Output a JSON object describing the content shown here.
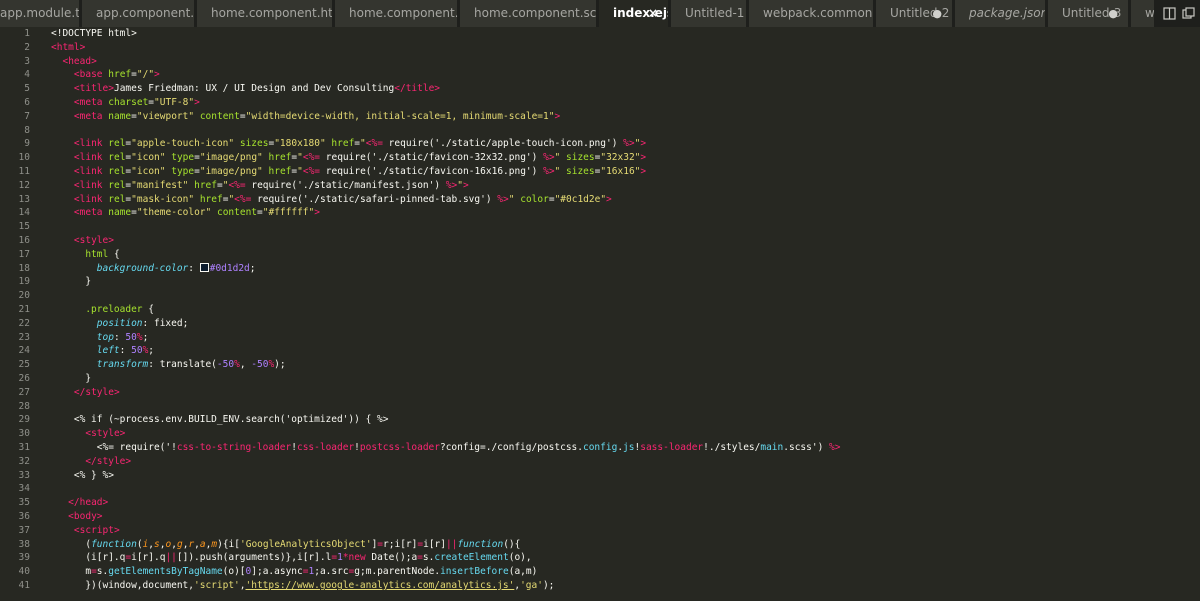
{
  "tabs": [
    {
      "label": "app.module.ts",
      "state": "",
      "active": false,
      "italic": false
    },
    {
      "label": "app.component.ts",
      "state": "",
      "active": false,
      "italic": false
    },
    {
      "label": "home.component.html",
      "state": "",
      "active": false,
      "italic": false
    },
    {
      "label": "home.component.ts",
      "state": "",
      "active": false,
      "italic": false
    },
    {
      "label": "home.component.scss",
      "state": "",
      "active": false,
      "italic": false
    },
    {
      "label": "index.ejs",
      "state": "×",
      "active": true,
      "italic": false
    },
    {
      "label": "Untitled-1",
      "state": "",
      "active": false,
      "italic": false
    },
    {
      "label": "webpack.common.js",
      "state": "",
      "active": false,
      "italic": false
    },
    {
      "label": "Untitled-2",
      "state": "●",
      "active": false,
      "italic": false
    },
    {
      "label": "package.json",
      "state": "",
      "active": false,
      "italic": true
    },
    {
      "label": "Untitled-3",
      "state": "●",
      "active": false,
      "italic": false
    },
    {
      "label": "wel",
      "state": "",
      "active": false,
      "italic": false
    }
  ],
  "icons": {
    "split": "split-editor-icon",
    "more": "more-actions-icon"
  },
  "colors": {
    "background": "#272822",
    "tag": "#f92672",
    "attribute": "#a6e22e",
    "string": "#e6db74",
    "property": "#66d9ef",
    "number": "#ae81ff"
  },
  "lines": [
    [
      [
        "t",
        "<!DOCTYPE html>"
      ]
    ],
    [
      [
        "g",
        "<"
      ],
      [
        "tag",
        "html"
      ],
      [
        "g",
        ">"
      ]
    ],
    [
      [
        "t",
        "  "
      ],
      [
        "g",
        "<"
      ],
      [
        "tag",
        "head"
      ],
      [
        "g",
        ">"
      ]
    ],
    [
      [
        "t",
        "    "
      ],
      [
        "g",
        "<"
      ],
      [
        "tag",
        "base"
      ],
      [
        "t",
        " "
      ],
      [
        "attr",
        "href"
      ],
      [
        "t",
        "="
      ],
      [
        "str",
        "\"/\""
      ],
      [
        "g",
        ">"
      ]
    ],
    [
      [
        "t",
        "    "
      ],
      [
        "g",
        "<"
      ],
      [
        "tag",
        "title"
      ],
      [
        "g",
        ">"
      ],
      [
        "t",
        "James Friedman: UX / UI Design and Dev Consulting"
      ],
      [
        "g",
        "</"
      ],
      [
        "tag",
        "title"
      ],
      [
        "g",
        ">"
      ]
    ],
    [
      [
        "t",
        "    "
      ],
      [
        "g",
        "<"
      ],
      [
        "tag",
        "meta"
      ],
      [
        "t",
        " "
      ],
      [
        "attr",
        "charset"
      ],
      [
        "t",
        "="
      ],
      [
        "str",
        "\"UTF-8\""
      ],
      [
        "g",
        ">"
      ]
    ],
    [
      [
        "t",
        "    "
      ],
      [
        "g",
        "<"
      ],
      [
        "tag",
        "meta"
      ],
      [
        "t",
        " "
      ],
      [
        "attr",
        "name"
      ],
      [
        "t",
        "="
      ],
      [
        "str",
        "\"viewport\""
      ],
      [
        "t",
        " "
      ],
      [
        "attr",
        "content"
      ],
      [
        "t",
        "="
      ],
      [
        "str",
        "\"width=device-width, initial-scale=1, minimum-scale=1\""
      ],
      [
        "g",
        ">"
      ]
    ],
    [],
    [
      [
        "t",
        "    "
      ],
      [
        "g",
        "<"
      ],
      [
        "tag",
        "link"
      ],
      [
        "t",
        " "
      ],
      [
        "attr",
        "rel"
      ],
      [
        "t",
        "="
      ],
      [
        "str",
        "\"apple-touch-icon\""
      ],
      [
        "t",
        " "
      ],
      [
        "attr",
        "sizes"
      ],
      [
        "t",
        "="
      ],
      [
        "str",
        "\"180x180\""
      ],
      [
        "t",
        " "
      ],
      [
        "attr",
        "href"
      ],
      [
        "t",
        "="
      ],
      [
        "str",
        "\""
      ],
      [
        "tag",
        "<%="
      ],
      [
        "t",
        " require('./static/apple-touch-icon.png') "
      ],
      [
        "tag",
        "%>"
      ],
      [
        "str",
        "\""
      ],
      [
        "g",
        ">"
      ]
    ],
    [
      [
        "t",
        "    "
      ],
      [
        "g",
        "<"
      ],
      [
        "tag",
        "link"
      ],
      [
        "t",
        " "
      ],
      [
        "attr",
        "rel"
      ],
      [
        "t",
        "="
      ],
      [
        "str",
        "\"icon\""
      ],
      [
        "t",
        " "
      ],
      [
        "attr",
        "type"
      ],
      [
        "t",
        "="
      ],
      [
        "str",
        "\"image/png\""
      ],
      [
        "t",
        " "
      ],
      [
        "attr",
        "href"
      ],
      [
        "t",
        "="
      ],
      [
        "str",
        "\""
      ],
      [
        "tag",
        "<%="
      ],
      [
        "t",
        " require('./static/favicon-32x32.png') "
      ],
      [
        "tag",
        "%>"
      ],
      [
        "str",
        "\""
      ],
      [
        "t",
        " "
      ],
      [
        "attr",
        "sizes"
      ],
      [
        "t",
        "="
      ],
      [
        "str",
        "\"32x32\""
      ],
      [
        "g",
        ">"
      ]
    ],
    [
      [
        "t",
        "    "
      ],
      [
        "g",
        "<"
      ],
      [
        "tag",
        "link"
      ],
      [
        "t",
        " "
      ],
      [
        "attr",
        "rel"
      ],
      [
        "t",
        "="
      ],
      [
        "str",
        "\"icon\""
      ],
      [
        "t",
        " "
      ],
      [
        "attr",
        "type"
      ],
      [
        "t",
        "="
      ],
      [
        "str",
        "\"image/png\""
      ],
      [
        "t",
        " "
      ],
      [
        "attr",
        "href"
      ],
      [
        "t",
        "="
      ],
      [
        "str",
        "\""
      ],
      [
        "tag",
        "<%="
      ],
      [
        "t",
        " require('./static/favicon-16x16.png') "
      ],
      [
        "tag",
        "%>"
      ],
      [
        "str",
        "\""
      ],
      [
        "t",
        " "
      ],
      [
        "attr",
        "sizes"
      ],
      [
        "t",
        "="
      ],
      [
        "str",
        "\"16x16\""
      ],
      [
        "g",
        ">"
      ]
    ],
    [
      [
        "t",
        "    "
      ],
      [
        "g",
        "<"
      ],
      [
        "tag",
        "link"
      ],
      [
        "t",
        " "
      ],
      [
        "attr",
        "rel"
      ],
      [
        "t",
        "="
      ],
      [
        "str",
        "\"manifest\""
      ],
      [
        "t",
        " "
      ],
      [
        "attr",
        "href"
      ],
      [
        "t",
        "="
      ],
      [
        "str",
        "\""
      ],
      [
        "tag",
        "<%="
      ],
      [
        "t",
        " require('./static/manifest.json') "
      ],
      [
        "tag",
        "%>"
      ],
      [
        "str",
        "\""
      ],
      [
        "g",
        ">"
      ]
    ],
    [
      [
        "t",
        "    "
      ],
      [
        "g",
        "<"
      ],
      [
        "tag",
        "link"
      ],
      [
        "t",
        " "
      ],
      [
        "attr",
        "rel"
      ],
      [
        "t",
        "="
      ],
      [
        "str",
        "\"mask-icon\""
      ],
      [
        "t",
        " "
      ],
      [
        "attr",
        "href"
      ],
      [
        "t",
        "="
      ],
      [
        "str",
        "\""
      ],
      [
        "tag",
        "<%="
      ],
      [
        "t",
        " require('./static/safari-pinned-tab.svg') "
      ],
      [
        "tag",
        "%>"
      ],
      [
        "str",
        "\""
      ],
      [
        "t",
        " "
      ],
      [
        "attr",
        "color"
      ],
      [
        "t",
        "="
      ],
      [
        "str",
        "\"#0c1d2e\""
      ],
      [
        "g",
        ">"
      ]
    ],
    [
      [
        "t",
        "    "
      ],
      [
        "g",
        "<"
      ],
      [
        "tag",
        "meta"
      ],
      [
        "t",
        " "
      ],
      [
        "attr",
        "name"
      ],
      [
        "t",
        "="
      ],
      [
        "str",
        "\"theme-color\""
      ],
      [
        "t",
        " "
      ],
      [
        "attr",
        "content"
      ],
      [
        "t",
        "="
      ],
      [
        "str",
        "\"#ffffff\""
      ],
      [
        "g",
        ">"
      ]
    ],
    [],
    [
      [
        "t",
        "    "
      ],
      [
        "g",
        "<"
      ],
      [
        "tag",
        "style"
      ],
      [
        "g",
        ">"
      ]
    ],
    [
      [
        "t",
        "      "
      ],
      [
        "sel",
        "html"
      ],
      [
        "t",
        " {"
      ]
    ],
    [
      [
        "t",
        "        "
      ],
      [
        "prop",
        "background-color"
      ],
      [
        "t",
        ": "
      ],
      [
        "swatch",
        ""
      ],
      [
        "num",
        "#0d1d2d"
      ],
      [
        "t",
        ";"
      ]
    ],
    [
      [
        "t",
        "      }"
      ]
    ],
    [],
    [
      [
        "t",
        "      "
      ],
      [
        "sel",
        ".preloader"
      ],
      [
        "t",
        " {"
      ]
    ],
    [
      [
        "t",
        "        "
      ],
      [
        "prop",
        "position"
      ],
      [
        "t",
        ": "
      ],
      [
        "t",
        "fixed"
      ],
      [
        "t",
        ";"
      ]
    ],
    [
      [
        "t",
        "        "
      ],
      [
        "prop",
        "top"
      ],
      [
        "t",
        ": "
      ],
      [
        "num",
        "50"
      ],
      [
        "unit",
        "%"
      ],
      [
        "t",
        ";"
      ]
    ],
    [
      [
        "t",
        "        "
      ],
      [
        "prop",
        "left"
      ],
      [
        "t",
        ": "
      ],
      [
        "num",
        "50"
      ],
      [
        "unit",
        "%"
      ],
      [
        "t",
        ";"
      ]
    ],
    [
      [
        "t",
        "        "
      ],
      [
        "prop",
        "transform"
      ],
      [
        "t",
        ": "
      ],
      [
        "t",
        "translate("
      ],
      [
        "num",
        "-50"
      ],
      [
        "unit",
        "%"
      ],
      [
        "t",
        ", "
      ],
      [
        "num",
        "-50"
      ],
      [
        "unit",
        "%"
      ],
      [
        "t",
        ");"
      ]
    ],
    [
      [
        "t",
        "      }"
      ]
    ],
    [
      [
        "t",
        "    "
      ],
      [
        "g",
        "</"
      ],
      [
        "tag",
        "style"
      ],
      [
        "g",
        ">"
      ]
    ],
    [],
    [
      [
        "t",
        "    "
      ],
      [
        "t",
        "<% if (~process.env.BUILD_ENV.search('optimized')) { %>"
      ]
    ],
    [
      [
        "t",
        "      "
      ],
      [
        "g",
        "<"
      ],
      [
        "tag",
        "style"
      ],
      [
        "g",
        ">"
      ]
    ],
    [
      [
        "t",
        "        "
      ],
      [
        "t",
        "<%= require('!"
      ],
      [
        "kw",
        "css-to-string-loader"
      ],
      [
        "t",
        "!"
      ],
      [
        "kw",
        "css-loader"
      ],
      [
        "t",
        "!"
      ],
      [
        "kw",
        "postcss-loader"
      ],
      [
        "t",
        "?config=./config/postcss."
      ],
      [
        "fn",
        "config"
      ],
      [
        "t",
        "."
      ],
      [
        "fn",
        "js"
      ],
      [
        "t",
        "!"
      ],
      [
        "kw",
        "sass-loader"
      ],
      [
        "t",
        "!./styles/"
      ],
      [
        "fn",
        "main"
      ],
      [
        "t",
        ".scss') "
      ],
      [
        "kw",
        "%>"
      ]
    ],
    [
      [
        "t",
        "      "
      ],
      [
        "g",
        "</"
      ],
      [
        "tag",
        "style"
      ],
      [
        "g",
        ">"
      ]
    ],
    [
      [
        "t",
        "    "
      ],
      [
        "t",
        "<% } %>"
      ]
    ],
    [],
    [
      [
        "t",
        "   "
      ],
      [
        "g",
        "</"
      ],
      [
        "tag",
        "head"
      ],
      [
        "g",
        ">"
      ]
    ],
    [
      [
        "t",
        "   "
      ],
      [
        "g",
        "<"
      ],
      [
        "tag",
        "body"
      ],
      [
        "g",
        ">"
      ]
    ],
    [
      [
        "t",
        "    "
      ],
      [
        "g",
        "<"
      ],
      [
        "tag",
        "script"
      ],
      [
        "g",
        ">"
      ]
    ],
    [
      [
        "t",
        "      "
      ],
      [
        "t",
        "("
      ],
      [
        "it",
        "function"
      ],
      [
        "t",
        "("
      ],
      [
        "parm",
        "i"
      ],
      [
        "t",
        ","
      ],
      [
        "parm",
        "s"
      ],
      [
        "t",
        ","
      ],
      [
        "parm",
        "o"
      ],
      [
        "t",
        ","
      ],
      [
        "parm",
        "g"
      ],
      [
        "t",
        ","
      ],
      [
        "parm",
        "r"
      ],
      [
        "t",
        ","
      ],
      [
        "parm",
        "a"
      ],
      [
        "t",
        ","
      ],
      [
        "parm",
        "m"
      ],
      [
        "t",
        "){i["
      ],
      [
        "str",
        "'GoogleAnalyticsObject'"
      ],
      [
        "t",
        "]"
      ],
      [
        "kw",
        "="
      ],
      [
        "t",
        "r;i[r]"
      ],
      [
        "kw",
        "="
      ],
      [
        "t",
        "i[r]"
      ],
      [
        "kw",
        "||"
      ],
      [
        "it",
        "function"
      ],
      [
        "t",
        "(){"
      ]
    ],
    [
      [
        "t",
        "      "
      ],
      [
        "t",
        "(i[r].q"
      ],
      [
        "kw",
        "="
      ],
      [
        "t",
        "i[r].q"
      ],
      [
        "kw",
        "||"
      ],
      [
        "t",
        "[]).push(arguments)},i[r].l"
      ],
      [
        "kw",
        "="
      ],
      [
        "num",
        "1"
      ],
      [
        "kw",
        "*new"
      ],
      [
        "t",
        " Date();a"
      ],
      [
        "kw",
        "="
      ],
      [
        "t",
        "s."
      ],
      [
        "fn",
        "createElement"
      ],
      [
        "t",
        "(o),"
      ]
    ],
    [
      [
        "t",
        "      "
      ],
      [
        "t",
        "m"
      ],
      [
        "kw",
        "="
      ],
      [
        "t",
        "s."
      ],
      [
        "fn",
        "getElementsByTagName"
      ],
      [
        "t",
        "(o)["
      ],
      [
        "num",
        "0"
      ],
      [
        "t",
        "];a.async"
      ],
      [
        "kw",
        "="
      ],
      [
        "num",
        "1"
      ],
      [
        "t",
        ";a.src"
      ],
      [
        "kw",
        "="
      ],
      [
        "t",
        "g;m.parentNode."
      ],
      [
        "fn",
        "insertBefore"
      ],
      [
        "t",
        "(a,m)"
      ]
    ],
    [
      [
        "t",
        "      "
      ],
      [
        "t",
        "})(window,document,"
      ],
      [
        "str",
        "'script'"
      ],
      [
        "t",
        ","
      ],
      [
        "link",
        "'https://www.google-analytics.com/analytics.js'"
      ],
      [
        "t",
        ","
      ],
      [
        "str",
        "'ga'"
      ],
      [
        "t",
        ");"
      ]
    ]
  ]
}
